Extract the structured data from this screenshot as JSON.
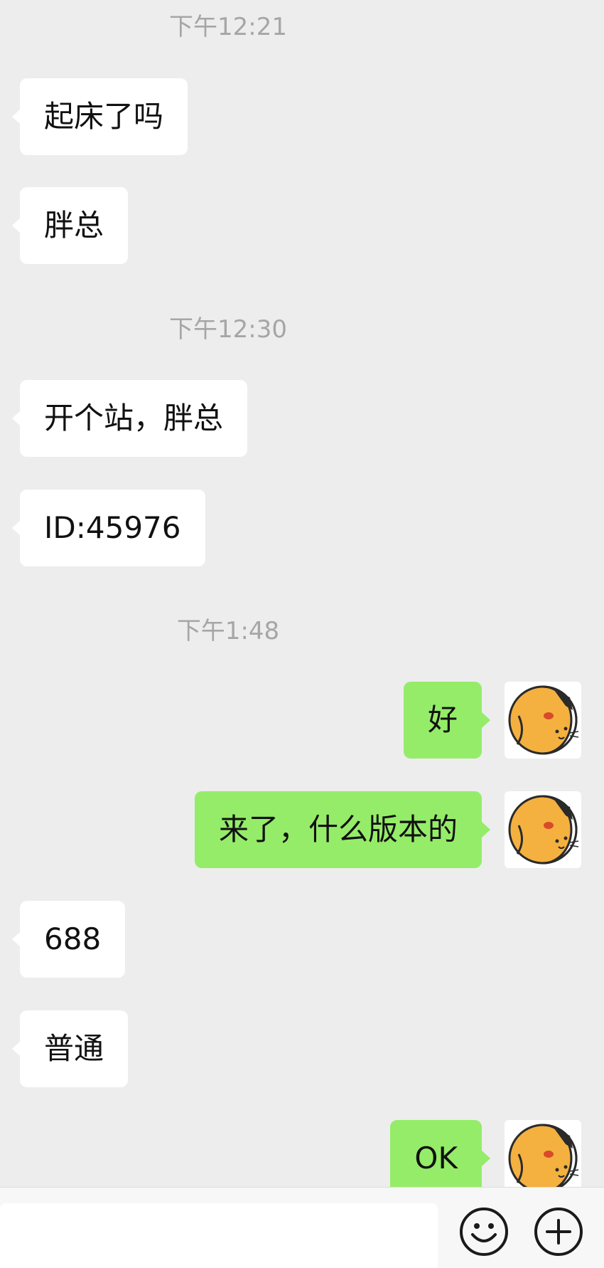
{
  "messages": [
    {
      "type": "time",
      "text": "下午12:21"
    },
    {
      "type": "msg",
      "side": "in",
      "text": "起床了吗"
    },
    {
      "type": "msg",
      "side": "in",
      "text": "胖总"
    },
    {
      "type": "time",
      "text": "下午12:30"
    },
    {
      "type": "msg",
      "side": "in",
      "text": "开个站，胖总"
    },
    {
      "type": "msg",
      "side": "in",
      "text": "ID:45976"
    },
    {
      "type": "time",
      "text": "下午1:48"
    },
    {
      "type": "msg",
      "side": "out",
      "text": "好"
    },
    {
      "type": "msg",
      "side": "out",
      "text": "来了，什么版本的"
    },
    {
      "type": "msg",
      "side": "in",
      "text": "688"
    },
    {
      "type": "msg",
      "side": "in",
      "text": "普通"
    },
    {
      "type": "msg",
      "side": "out",
      "text": "OK"
    }
  ],
  "avatar_icon": "dog-cat-avatar-icon",
  "bottom_bar": {
    "input_value": "",
    "emoji_icon": "smiley-face-icon",
    "plus_icon": "plus-circle-icon"
  },
  "colors": {
    "background": "#ededed",
    "incoming_bubble": "#ffffff",
    "outgoing_bubble": "#95ec69",
    "timestamp": "#a6a6a6"
  }
}
